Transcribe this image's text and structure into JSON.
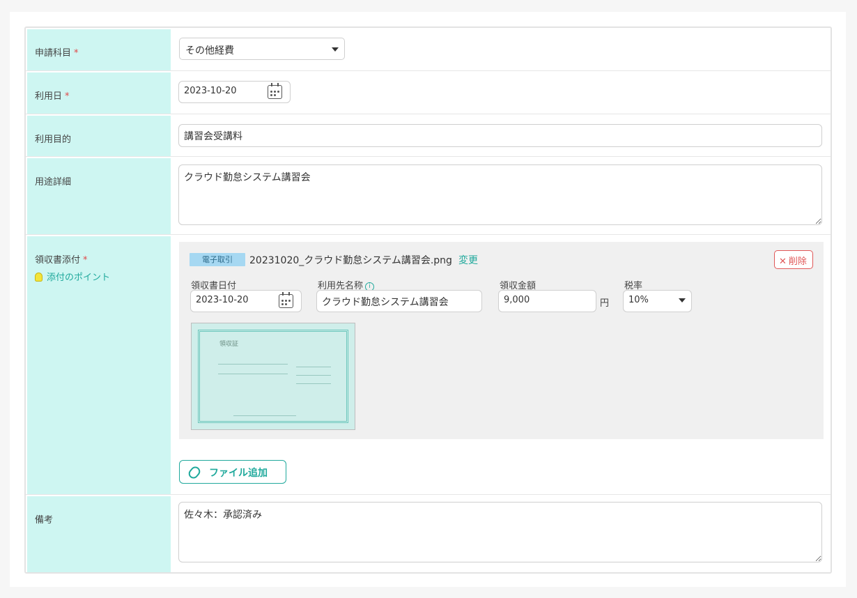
{
  "form": {
    "category": {
      "label": "申請科目",
      "required_mark": "*",
      "value": "その他経費"
    },
    "use_date": {
      "label": "利用日",
      "required_mark": "*",
      "value": "2023-10-20"
    },
    "purpose": {
      "label": "利用目的",
      "value": "講習会受講料"
    },
    "detail": {
      "label": "用途詳細",
      "value": "クラウド勤怠システム講習会"
    },
    "receipt": {
      "label": "領収書添付",
      "required_mark": "*",
      "tip_label": "添付のポイント",
      "badge": "電子取引",
      "file_name": "20231020_クラウド勤怠システム講習会.png",
      "change_label": "変更",
      "delete_label": "削除",
      "receipt_date_label": "領収書日付",
      "receipt_date_value": "2023-10-20",
      "vendor_label": "利用先名称",
      "vendor_value": "クラウド勤怠システム講習会",
      "amount_label": "領収金額",
      "amount_value": "9,000",
      "currency_unit": "円",
      "tax_label": "税率",
      "tax_value": "10%",
      "thumbnail_title": "領収証",
      "add_file_label": "ファイル追加"
    },
    "notes": {
      "label": "備考",
      "value": "佐々木：承認済み"
    }
  },
  "colors": {
    "label_bg": "#cef6f2",
    "accent": "#20a99c",
    "danger": "#e05757",
    "badge_bg": "#a6d8f2"
  },
  "icons": [
    "calendar-icon",
    "info-icon",
    "bulb-icon",
    "paperclip-icon",
    "close-icon",
    "chevron-down-icon"
  ]
}
